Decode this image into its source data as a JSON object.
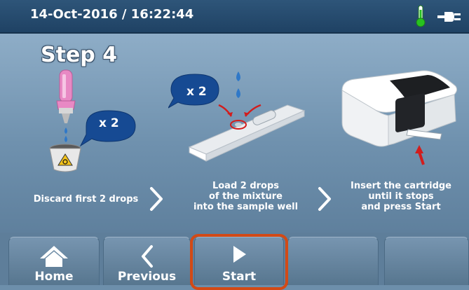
{
  "header": {
    "datetime": "14-Oct-2016 / 16:22:44",
    "icons": [
      "thermometer-icon",
      "power-plug-icon"
    ],
    "thermometer_color": "#27c21f"
  },
  "main": {
    "step_title": "Step 4",
    "steps": [
      {
        "caption_lines": [
          "Discard first 2 drops"
        ],
        "bubble_text": "x 2"
      },
      {
        "caption_lines": [
          "Load 2 drops",
          "of the mixture",
          "into the sample well"
        ],
        "bubble_text": "x 2"
      },
      {
        "caption_lines": [
          "Insert the cartridge",
          "until it stops",
          "and press Start"
        ]
      }
    ]
  },
  "nav": {
    "home_label": "Home",
    "previous_label": "Previous",
    "start_label": "Start",
    "highlight_color": "#d24a16"
  }
}
